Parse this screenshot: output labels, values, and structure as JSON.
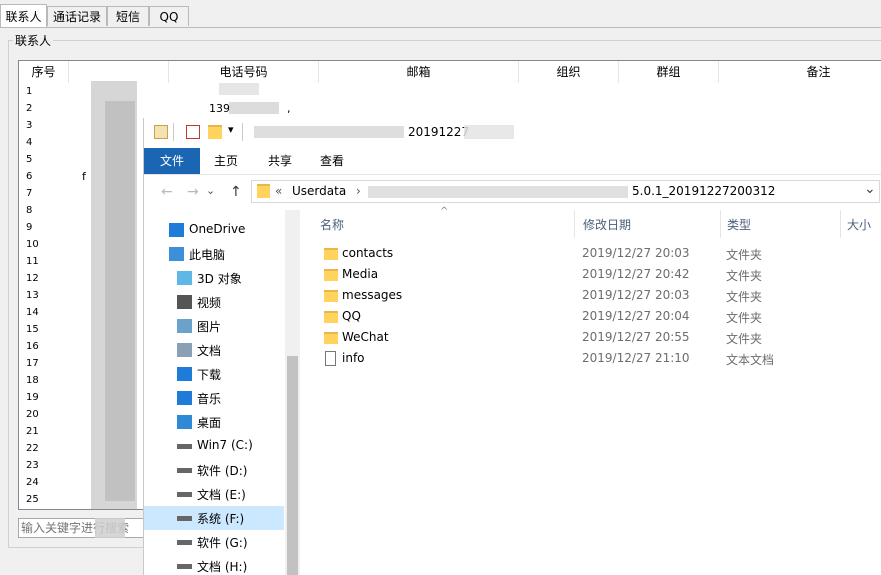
{
  "tabs": [
    {
      "label": "联系人",
      "active": true
    },
    {
      "label": "通话记录",
      "active": false
    },
    {
      "label": "短信",
      "active": false
    },
    {
      "label": "QQ",
      "active": false
    }
  ],
  "contacts_group": {
    "title": "联系人",
    "columns": [
      "序号",
      "",
      "电话号码",
      "邮箱",
      "组织",
      "群组",
      "备注"
    ],
    "rows": [
      "1",
      "2",
      "3",
      "4",
      "5",
      "6",
      "7",
      "8",
      "9",
      "10",
      "11",
      "12",
      "13",
      "14",
      "15",
      "16",
      "17",
      "18",
      "19",
      "20",
      "21",
      "22",
      "23",
      "24",
      "25"
    ],
    "visible_fragments": {
      "row2_phone": "139",
      "row6_name": "f",
      "row2_trailing": ","
    },
    "search_placeholder": "输入关键字进行搜索"
  },
  "explorer": {
    "title_fragment": "20191227",
    "ribbon_tabs": [
      "文件",
      "主页",
      "共享",
      "查看"
    ],
    "address": {
      "prefix": "«",
      "root": "Userdata",
      "tail": "5.0.1_20191227200312",
      "chevron": "⌄"
    },
    "nav_arrows": {
      "back": "←",
      "forward": "→",
      "up": "↑"
    },
    "nav_pane": [
      {
        "label": "OneDrive",
        "icon": "cloud-icon"
      },
      {
        "label": "此电脑",
        "icon": "computer-icon"
      },
      {
        "label": "3D 对象",
        "icon": "cube-icon"
      },
      {
        "label": "视频",
        "icon": "video-icon"
      },
      {
        "label": "图片",
        "icon": "picture-icon"
      },
      {
        "label": "文档",
        "icon": "document-icon"
      },
      {
        "label": "下载",
        "icon": "download-icon"
      },
      {
        "label": "音乐",
        "icon": "music-icon"
      },
      {
        "label": "桌面",
        "icon": "desktop-icon"
      },
      {
        "label": "Win7 (C:)",
        "icon": "drive-icon"
      },
      {
        "label": "软件 (D:)",
        "icon": "drive-icon"
      },
      {
        "label": "文档 (E:)",
        "icon": "drive-icon"
      },
      {
        "label": "系统 (F:)",
        "icon": "drive-icon",
        "selected": true
      },
      {
        "label": "软件 (G:)",
        "icon": "drive-icon"
      },
      {
        "label": "文档 (H:)",
        "icon": "drive-icon"
      }
    ],
    "columns": {
      "name": "名称",
      "date": "修改日期",
      "type": "类型",
      "size": "大小"
    },
    "files": [
      {
        "name": "contacts",
        "date": "2019/12/27 20:03",
        "type": "文件夹",
        "icon": "folder-icon"
      },
      {
        "name": "Media",
        "date": "2019/12/27 20:42",
        "type": "文件夹",
        "icon": "folder-icon"
      },
      {
        "name": "messages",
        "date": "2019/12/27 20:03",
        "type": "文件夹",
        "icon": "folder-icon"
      },
      {
        "name": "QQ",
        "date": "2019/12/27 20:04",
        "type": "文件夹",
        "icon": "folder-icon"
      },
      {
        "name": "WeChat",
        "date": "2019/12/27 20:55",
        "type": "文件夹",
        "icon": "folder-icon"
      },
      {
        "name": "info",
        "date": "2019/12/27 21:10",
        "type": "文本文档",
        "icon": "text-file-icon"
      }
    ]
  },
  "colors": {
    "ribbon_file_tab": "#1a66b3",
    "nav_selected": "#cce8ff",
    "folder": "#ffd35c",
    "header_text": "#4c607a"
  }
}
